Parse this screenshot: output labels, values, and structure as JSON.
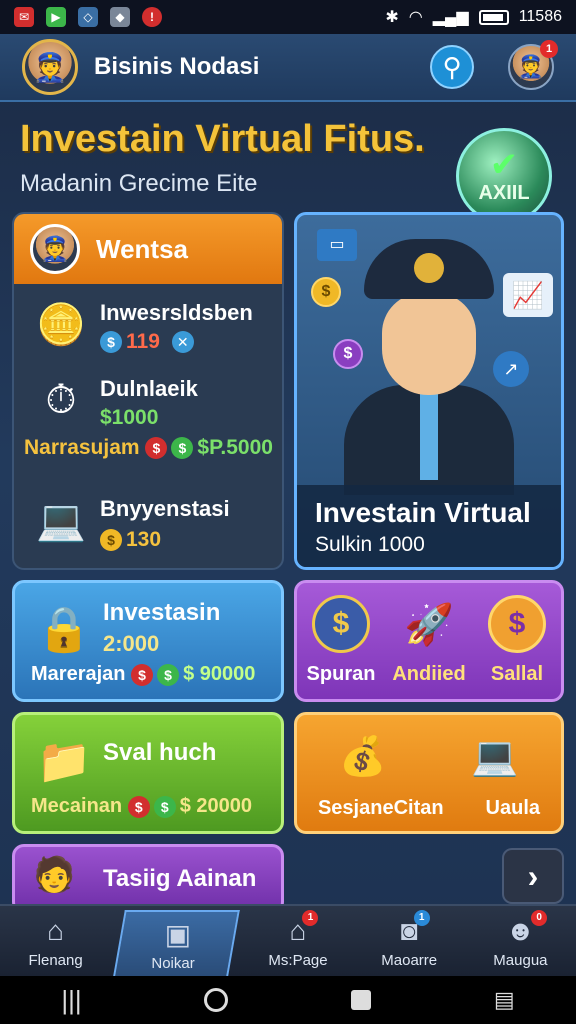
{
  "status_bar": {
    "time": "11586",
    "icons": [
      "notification-icon",
      "app-icon-green",
      "shield-icon",
      "security-icon",
      "alert-icon"
    ]
  },
  "header": {
    "title": "Bisinis Nodasi",
    "profile_badge": "1"
  },
  "hero": {
    "title": "Investain Virtual Fitus.",
    "subtitle": "Madanin Grecime Eite",
    "badge_text": "AXIIL"
  },
  "left_panel": {
    "title": "Wentsa",
    "rows": [
      {
        "label": "Inwesrsldsben",
        "value": "119"
      },
      {
        "label": "Dulnlaeik",
        "value": "$1000"
      },
      {
        "label": "Bnyyenstasi",
        "value": "130"
      }
    ],
    "footer_label": "Narrasujam",
    "footer_value": "$P.5000"
  },
  "feature_card": {
    "title": "Investain Virtual",
    "subtitle": "Sulkin 1000"
  },
  "blue_card": {
    "title": "Investasin",
    "value": "2:000",
    "footer_label": "Marerajan",
    "footer_value": "$ 90000"
  },
  "purple_card": {
    "items": [
      {
        "label": "Spuran"
      },
      {
        "label": "Andiied"
      },
      {
        "label": "Sallal"
      }
    ]
  },
  "green_card": {
    "title": "Sval huch",
    "footer_label": "Mecainan",
    "footer_value": "$ 20000"
  },
  "orange_card": {
    "labels": [
      "SesjaneCitan",
      "Uaula"
    ]
  },
  "purple2_card": {
    "title": "Tasiig Aainan"
  },
  "bottom_nav": [
    {
      "label": "Flenang",
      "icon": "home-icon"
    },
    {
      "label": "Noikar",
      "icon": "portrait-icon"
    },
    {
      "label": "Ms:Page",
      "icon": "house-icon",
      "badge": "1"
    },
    {
      "label": "Maoarre",
      "icon": "camera-icon",
      "badge": "1"
    },
    {
      "label": "Maugua",
      "icon": "user-icon",
      "badge": "0"
    }
  ]
}
